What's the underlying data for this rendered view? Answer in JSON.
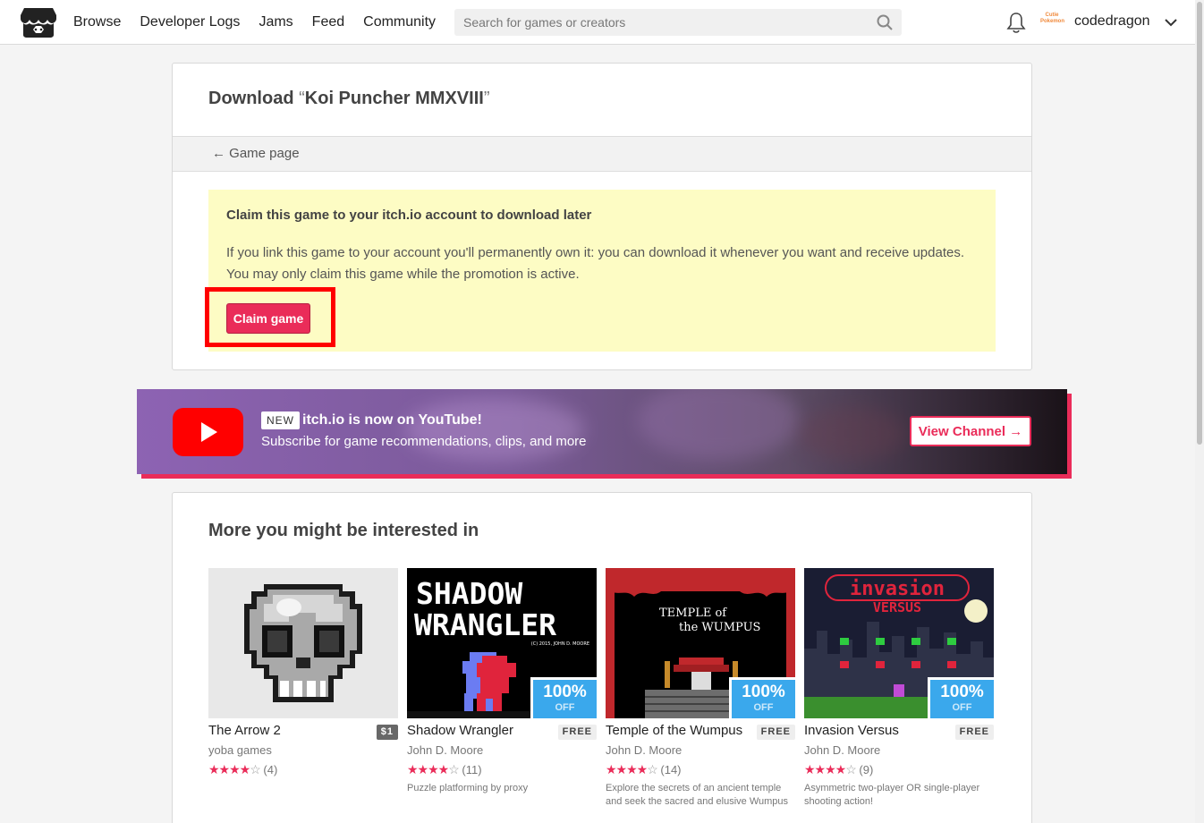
{
  "nav": {
    "items": [
      "Browse",
      "Developer Logs",
      "Jams",
      "Feed",
      "Community"
    ],
    "search_placeholder": "Search for games or creators",
    "avatar_text": "Cutie Pokemon",
    "username": "codedragon"
  },
  "download": {
    "title_prefix": "Download",
    "open_quote": "“",
    "game_name": "Koi Puncher MMXVIII",
    "close_quote": "”",
    "back_arrow": "←",
    "back_link": "Game page"
  },
  "claim": {
    "heading": "Claim this game to your itch.io account to download later",
    "body": "If you link this game to your account you'll permanently own it: you can download it whenever you want and receive updates. You may only claim this game while the promotion is active.",
    "button": "Claim game"
  },
  "youtube": {
    "badge": "NEW",
    "title": "itch.io is now on YouTube!",
    "subtitle": "Subscribe for game recommendations, clips, and more",
    "button": "View Channel →"
  },
  "recommendations": {
    "heading": "More you might be interested in",
    "sale_percent": "100%",
    "sale_off": "OFF",
    "games": [
      {
        "title": "The Arrow 2",
        "price": "$1",
        "author": "yoba games",
        "stars_full": "★★★★",
        "stars_empty": "☆",
        "rating_count": "(4)",
        "description": "",
        "on_sale": false
      },
      {
        "title": "Shadow Wrangler",
        "price": "FREE",
        "author": "John D. Moore",
        "stars_full": "★★★★",
        "stars_empty": "☆",
        "rating_count": "(11)",
        "description": "Puzzle platforming by proxy",
        "on_sale": true,
        "cover_text": [
          "SHADOW",
          "WRANGLER",
          "(C) 2015, JOHN D. MOORE"
        ]
      },
      {
        "title": "Temple of the Wumpus",
        "price": "FREE",
        "author": "John D. Moore",
        "stars_full": "★★★★",
        "stars_empty": "☆",
        "rating_count": "(14)",
        "description": "Explore the secrets of an ancient temple and seek the sacred and elusive Wumpus",
        "on_sale": true,
        "cover_text": [
          "TEMPLE of",
          "the WUMPUS"
        ]
      },
      {
        "title": "Invasion Versus",
        "price": "FREE",
        "author": "John D. Moore",
        "stars_full": "★★★★",
        "stars_empty": "☆",
        "rating_count": "(9)",
        "description": "Asymmetric two-player OR single-player shooting action!",
        "on_sale": true,
        "cover_text": [
          "invasion",
          "VERSUS"
        ]
      }
    ]
  },
  "colors": {
    "accent": "#ea2c59",
    "claim_bg": "#fdfcc4",
    "highlight": "#ff0000",
    "sale": "#3aa8ec",
    "youtube_red": "#ff0000"
  }
}
